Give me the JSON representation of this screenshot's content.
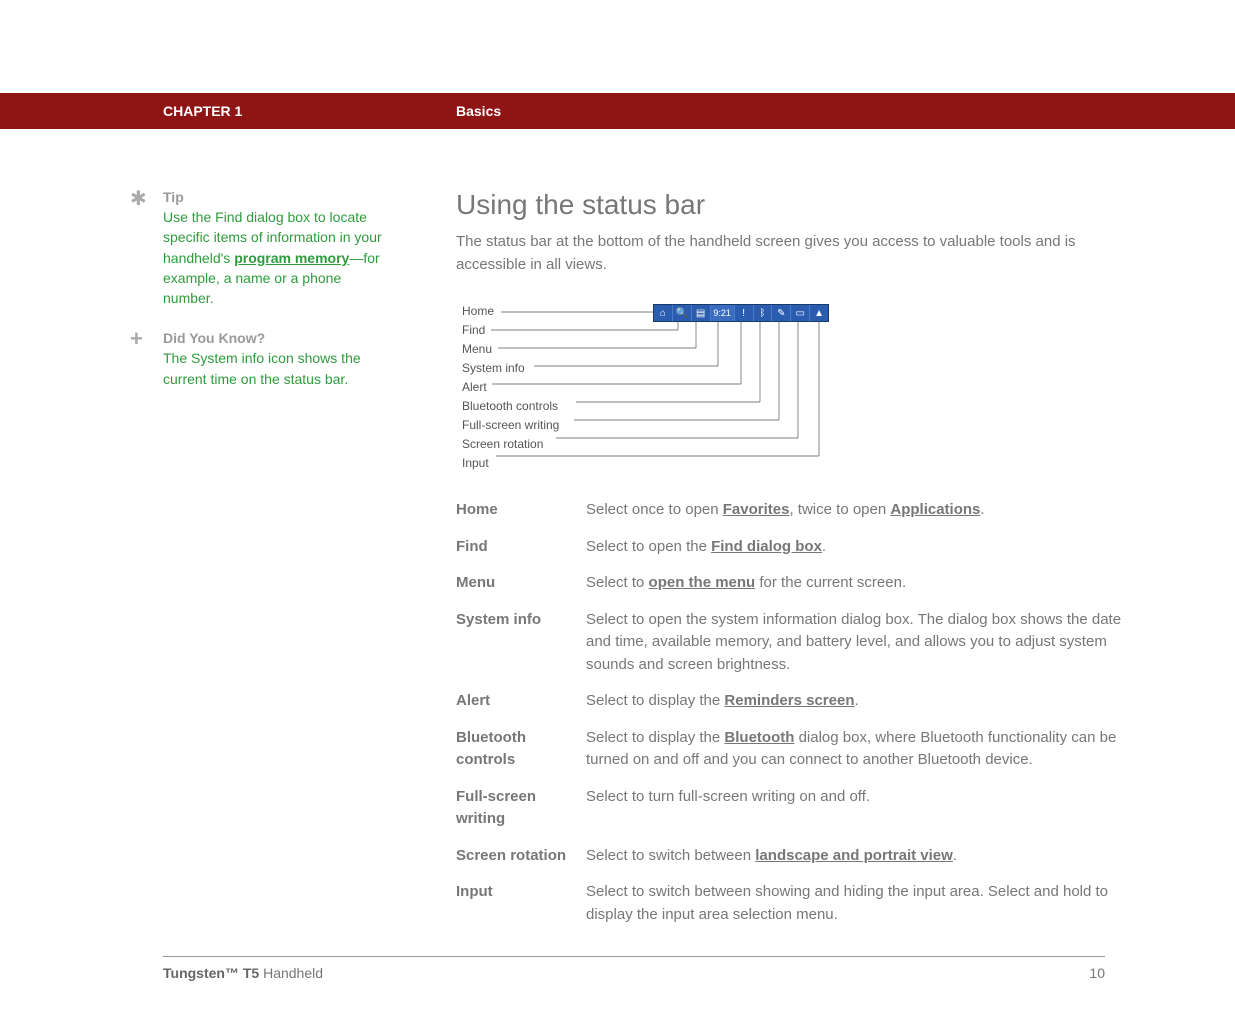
{
  "header": {
    "chapter": "CHAPTER 1",
    "section": "Basics"
  },
  "sidebar": {
    "tip": {
      "heading": "Tip",
      "text_before": "Use the Find dialog box to locate specific items of information in your handheld's ",
      "link": "program memory",
      "text_after": "—for example, a name or a phone number."
    },
    "dyk": {
      "heading": "Did You Know?",
      "text": "The System info icon shows the current time on the status bar."
    }
  },
  "main": {
    "title": "Using the status bar",
    "intro": "The status bar at the bottom of the handheld screen gives you access to valuable tools and is accessible in all views.",
    "diagram_labels": [
      "Home",
      "Find",
      "Menu",
      "System info",
      "Alert",
      "Bluetooth controls",
      "Full-screen writing",
      "Screen rotation",
      "Input"
    ],
    "statusbar_time": "9:21",
    "definitions": [
      {
        "term": "Home",
        "parts": [
          {
            "t": "Select once to open "
          },
          {
            "t": "Favorites",
            "link": true
          },
          {
            "t": ", twice to open "
          },
          {
            "t": "Applications",
            "link": true
          },
          {
            "t": "."
          }
        ]
      },
      {
        "term": "Find",
        "parts": [
          {
            "t": "Select to open the "
          },
          {
            "t": "Find dialog box",
            "link": true
          },
          {
            "t": "."
          }
        ]
      },
      {
        "term": "Menu",
        "parts": [
          {
            "t": "Select to "
          },
          {
            "t": "open the menu",
            "link": true
          },
          {
            "t": " for the current screen."
          }
        ]
      },
      {
        "term": "System info",
        "parts": [
          {
            "t": "Select to open the system information dialog box. The dialog box shows the date and time, available memory, and battery level, and allows you to adjust system sounds and screen brightness."
          }
        ]
      },
      {
        "term": "Alert",
        "parts": [
          {
            "t": "Select to display the "
          },
          {
            "t": "Reminders screen",
            "link": true
          },
          {
            "t": "."
          }
        ]
      },
      {
        "term": "Bluetooth controls",
        "parts": [
          {
            "t": "Select to display the "
          },
          {
            "t": "Bluetooth",
            "link": true
          },
          {
            "t": " dialog box, where Bluetooth functionality can be turned on and off and you can connect to another Bluetooth device."
          }
        ]
      },
      {
        "term": "Full-screen writing",
        "parts": [
          {
            "t": "Select to turn full-screen writing on and off."
          }
        ]
      },
      {
        "term": "Screen rotation",
        "parts": [
          {
            "t": "Select to switch between "
          },
          {
            "t": "landscape and portrait view",
            "link": true
          },
          {
            "t": "."
          }
        ]
      },
      {
        "term": "Input",
        "parts": [
          {
            "t": "Select to switch between showing and hiding the input area. Select and hold to display the input area selection menu."
          }
        ]
      }
    ]
  },
  "footer": {
    "product_bold": "Tungsten™ T5",
    "product_rest": " Handheld",
    "page_number": "10"
  }
}
